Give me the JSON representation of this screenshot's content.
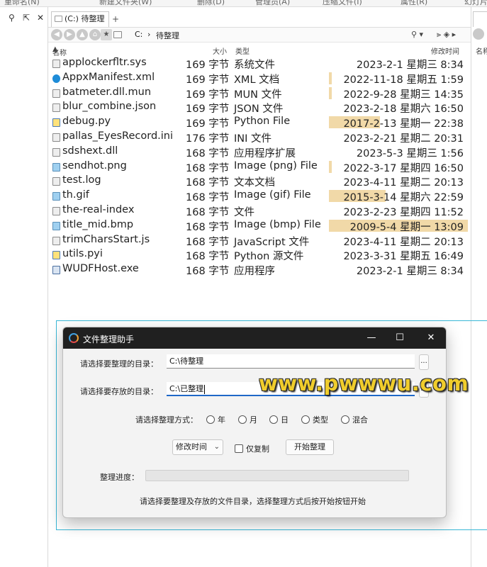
{
  "toolbar": {
    "items": [
      "重命名(N)",
      "新建文件夹(W)",
      "删除(D)",
      "管理员(A)",
      "压缩文件(I)",
      "属性(R)",
      "幻灯片"
    ]
  },
  "tab": {
    "label": "(C:) 待整理",
    "add": "+"
  },
  "nav": {
    "crumbs": [
      "C:",
      "›",
      "待整理"
    ]
  },
  "columns": {
    "name": "名称",
    "size": "大小",
    "type": "类型",
    "mtime": "修改时间"
  },
  "files": [
    {
      "name": "applockerfltr.sys",
      "size": "169 字节",
      "type": "系统文件",
      "date": "2023-2-1 星期三   8:34",
      "icon": "file-icon",
      "bar": "none"
    },
    {
      "name": "AppxManifest.xml",
      "size": "169 字节",
      "type": "XML 文档",
      "date": "2022-11-18 星期五   1:59",
      "icon": "edge-icon",
      "bar": "thin"
    },
    {
      "name": "batmeter.dll.mun",
      "size": "169 字节",
      "type": "MUN 文件",
      "date": "2022-9-28 星期三 14:35",
      "icon": "file-icon",
      "bar": "thin"
    },
    {
      "name": "blur_combine.json",
      "size": "169 字节",
      "type": "JSON 文件",
      "date": "2023-2-18 星期六 16:50",
      "icon": "file-icon",
      "bar": "none"
    },
    {
      "name": "debug.py",
      "size": "169 字节",
      "type": "Python File",
      "date": "2017-2-13 星期一 22:38",
      "icon": "python-icon",
      "bar": "wide"
    },
    {
      "name": "pallas_EyesRecord.ini",
      "size": "176 字节",
      "type": "INI 文件",
      "date": "2023-2-21 星期二 20:31",
      "icon": "file-icon",
      "bar": "none"
    },
    {
      "name": "sdshext.dll",
      "size": "168 字节",
      "type": "应用程序扩展",
      "date": "2023-5-3 星期三   1:56",
      "icon": "file-icon",
      "bar": "none"
    },
    {
      "name": "sendhot.png",
      "size": "168 字节",
      "type": "Image (png) File",
      "date": "2022-3-17 星期四 16:50",
      "icon": "image-icon",
      "bar": "thin"
    },
    {
      "name": "test.log",
      "size": "168 字节",
      "type": "文本文档",
      "date": "2023-4-11 星期二 20:13",
      "icon": "file-icon",
      "bar": "none"
    },
    {
      "name": "th.gif",
      "size": "168 字节",
      "type": "Image (gif) File",
      "date": "2015-3-14 星期六 22:59",
      "icon": "image-icon",
      "bar": "wider"
    },
    {
      "name": "the-real-index",
      "size": "168 字节",
      "type": "文件",
      "date": "2023-2-23 星期四 11:52",
      "icon": "file-icon",
      "bar": "none"
    },
    {
      "name": "title_mid.bmp",
      "size": "168 字节",
      "type": "Image (bmp) File",
      "date": "2009-5-4 星期一 13:09",
      "icon": "image-icon",
      "bar": "full"
    },
    {
      "name": "trimCharsStart.js",
      "size": "168 字节",
      "type": "JavaScript 文件",
      "date": "2023-4-11 星期二 20:13",
      "icon": "file-icon",
      "bar": "none"
    },
    {
      "name": "utils.pyi",
      "size": "168 字节",
      "type": "Python 源文件",
      "date": "2023-3-31 星期五 16:49",
      "icon": "python-icon",
      "bar": "none"
    },
    {
      "name": "WUDFHost.exe",
      "size": "168 字节",
      "type": "应用程序",
      "date": "2023-2-1 星期三   8:34",
      "icon": "exe-icon",
      "bar": "none"
    }
  ],
  "right_pane": {
    "col_name": "名称"
  },
  "dialog": {
    "title": "文件整理助手",
    "min": "—",
    "max": "☐",
    "close": "✕",
    "source_label": "请选择要整理的目录：",
    "source_value": "C:\\待整理",
    "target_label": "请选择要存放的目录：",
    "target_value": "C:\\已整理",
    "browse": "...",
    "mode_label": "请选择整理方式：",
    "modes": [
      "年",
      "月",
      "日",
      "类型",
      "混合"
    ],
    "sort_select": "修改时间",
    "copy_only": "仅复制",
    "start_button": "开始整理",
    "progress_label": "整理进度：",
    "progress": 0,
    "hint": "请选择要整理及存放的文件目录，选择整理方式后按开始按钮开始"
  },
  "watermark": "www.pwwwu.com"
}
